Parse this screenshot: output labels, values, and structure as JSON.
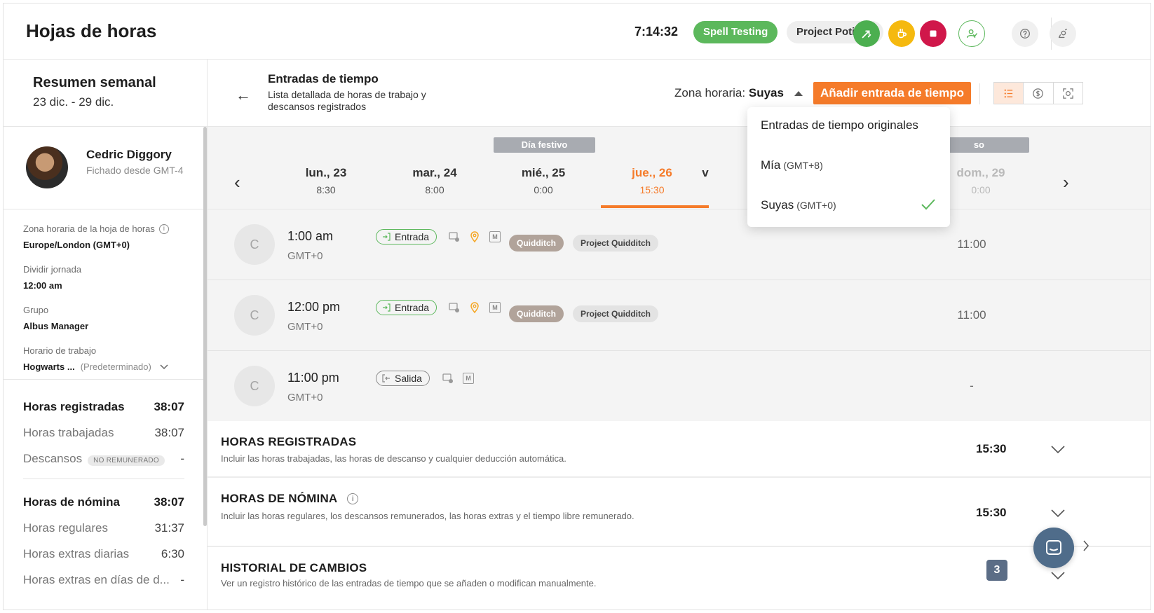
{
  "header": {
    "title": "Hojas de horas",
    "timer": "7:14:32",
    "activity_label": "Spell Testing",
    "project_label": "Project Potions",
    "action_colors": {
      "switch": "#4caf50",
      "break": "#f5b90f",
      "stop": "#d0174a",
      "user": "#5cb85c"
    },
    "icons": [
      "switch-activity-icon",
      "coffee-break-icon",
      "stop-icon",
      "user-check-icon",
      "help-icon",
      "settings-icon"
    ]
  },
  "summary": {
    "title": "Resumen semanal",
    "range": "23 dic. - 29 dic.",
    "user_name": "Cedric Diggory",
    "user_sub": "Fichado desde GMT-4",
    "timezone_label": "Zona horaria de la hoja de horas",
    "timezone_value": "Europe/London (GMT+0)",
    "split_label": "Dividir jornada",
    "split_value": "12:00 am",
    "group_label": "Grupo",
    "group_value": "Albus Manager",
    "schedule_label": "Horario de trabajo",
    "schedule_value": "Hogwarts ...",
    "schedule_default": "(Predeterminado)",
    "stats": [
      {
        "label": "Horas registradas",
        "value": "38:07",
        "bold": true
      },
      {
        "label": "Horas trabajadas",
        "value": "38:07",
        "bold": false
      },
      {
        "label": "Descansos",
        "badge": "NO REMUNERADO",
        "value": "-",
        "bold": false
      }
    ],
    "payroll": [
      {
        "label": "Horas de nómina",
        "value": "38:07",
        "bold": true
      },
      {
        "label": "Horas regulares",
        "value": "31:37",
        "bold": false
      },
      {
        "label": "Horas extras diarias",
        "value": "6:30",
        "bold": false
      },
      {
        "label": "Horas extras en días de d...",
        "value": "-",
        "bold": false
      }
    ]
  },
  "main": {
    "title": "Entradas de tiempo",
    "subtitle": "Lista detallada de horas de trabajo y descansos registrados",
    "tz_prefix": "Zona horaria:",
    "tz_value": "Suyas",
    "add_button": "Añadir entrada de tiempo",
    "accent": "#f57b2a",
    "view_icons": [
      "list-view-icon",
      "dollar-view-icon",
      "screenshot-view-icon"
    ]
  },
  "days": {
    "holiday_label": "Día festivo",
    "holiday_label_partial": "so",
    "list": [
      {
        "name": "lun., 23",
        "hours": "8:30"
      },
      {
        "name": "mar., 24",
        "hours": "8:00"
      },
      {
        "name": "mié., 25",
        "hours": "0:00"
      },
      {
        "name": "jue., 26",
        "hours": "15:30"
      },
      {
        "name": "v",
        "hours": ""
      },
      {
        "name": "dom., 29",
        "hours": "0:00"
      }
    ]
  },
  "entries": [
    {
      "avatar": "C",
      "time": "1:00 am",
      "tz": "GMT+0",
      "type": "Entrada",
      "task": "Quidditch",
      "project": "Project Quidditch",
      "hours": "11:00"
    },
    {
      "avatar": "C",
      "time": "12:00 pm",
      "tz": "GMT+0",
      "type": "Entrada",
      "task": "Quidditch",
      "project": "Project Quidditch",
      "hours": "11:00"
    },
    {
      "avatar": "C",
      "time": "11:00 pm",
      "tz": "GMT+0",
      "type": "Salida",
      "hours": "-"
    }
  ],
  "entry_m_label": "M",
  "sections": [
    {
      "title": "HORAS REGISTRADAS",
      "desc": "Incluir las horas trabajadas, las horas de descanso y cualquier deducción automática.",
      "value": "15:30"
    },
    {
      "title": "HORAS DE NÓMINA",
      "desc": "Incluir las horas regulares, los descansos remunerados, las horas extras y el tiempo libre remunerado.",
      "value": "15:30"
    },
    {
      "title": "HISTORIAL DE CAMBIOS",
      "desc": "Ver un registro histórico de las entradas de tiempo que se añaden o modifican manualmente.",
      "value": ""
    }
  ],
  "dropdown": {
    "items": [
      {
        "label": "Entradas de tiempo originales",
        "sub": ""
      },
      {
        "label": "Mía",
        "sub": "(GMT+8)"
      },
      {
        "label": "Suyas",
        "sub": "(GMT+0)",
        "selected": true
      }
    ]
  },
  "badge_count": "3"
}
